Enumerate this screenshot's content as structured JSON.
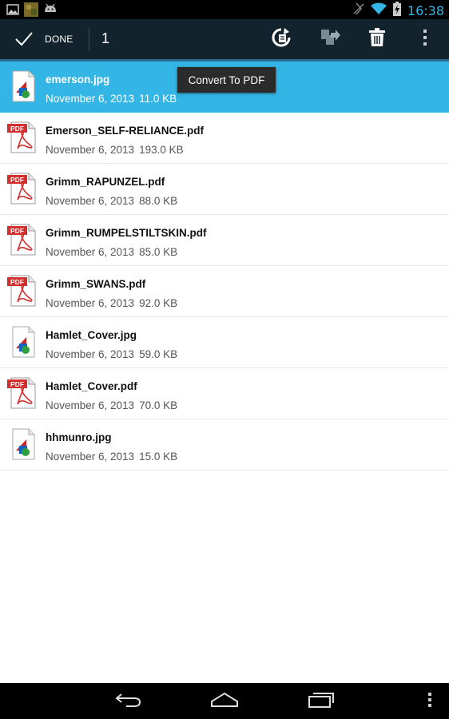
{
  "status_bar": {
    "time": "16:38",
    "left_icons": [
      "gallery-icon",
      "thumbnail-icon",
      "android-icon"
    ],
    "right_icons": [
      "no-sync-icon",
      "wifi-icon",
      "battery-charging-icon"
    ]
  },
  "action_bar": {
    "done_label": "DONE",
    "selected_count": "1",
    "actions": [
      "convert-icon",
      "share-icon",
      "delete-icon",
      "overflow-menu-icon"
    ]
  },
  "tooltip": {
    "text": "Convert To PDF"
  },
  "files": [
    {
      "name": "emerson.jpg",
      "date": "November 6, 2013",
      "size": "11.0 KB",
      "type": "jpg",
      "selected": true
    },
    {
      "name": "Emerson_SELF-RELIANCE.pdf",
      "date": "November 6, 2013",
      "size": "193.0 KB",
      "type": "pdf",
      "selected": false
    },
    {
      "name": "Grimm_RAPUNZEL.pdf",
      "date": "November 6, 2013",
      "size": "88.0 KB",
      "type": "pdf",
      "selected": false
    },
    {
      "name": "Grimm_RUMPELSTILTSKIN.pdf",
      "date": "November 6, 2013",
      "size": "85.0 KB",
      "type": "pdf",
      "selected": false
    },
    {
      "name": "Grimm_SWANS.pdf",
      "date": "November 6, 2013",
      "size": "92.0 KB",
      "type": "pdf",
      "selected": false
    },
    {
      "name": "Hamlet_Cover.jpg",
      "date": "November 6, 2013",
      "size": "59.0 KB",
      "type": "jpg",
      "selected": false
    },
    {
      "name": "Hamlet_Cover.pdf",
      "date": "November 6, 2013",
      "size": "70.0 KB",
      "type": "pdf",
      "selected": false
    },
    {
      "name": "hhmunro.jpg",
      "date": "November 6, 2013",
      "size": "15.0 KB",
      "type": "jpg",
      "selected": false
    }
  ],
  "pdf_icon_label": "PDF",
  "nav_bar": [
    "back-icon",
    "home-icon",
    "recent-apps-icon",
    "menu-icon"
  ],
  "colors": {
    "selection": "#33b5e5",
    "action_bar": "#13232d",
    "accent_line": "#2a6f8f",
    "pdf_red": "#d32f2f"
  }
}
